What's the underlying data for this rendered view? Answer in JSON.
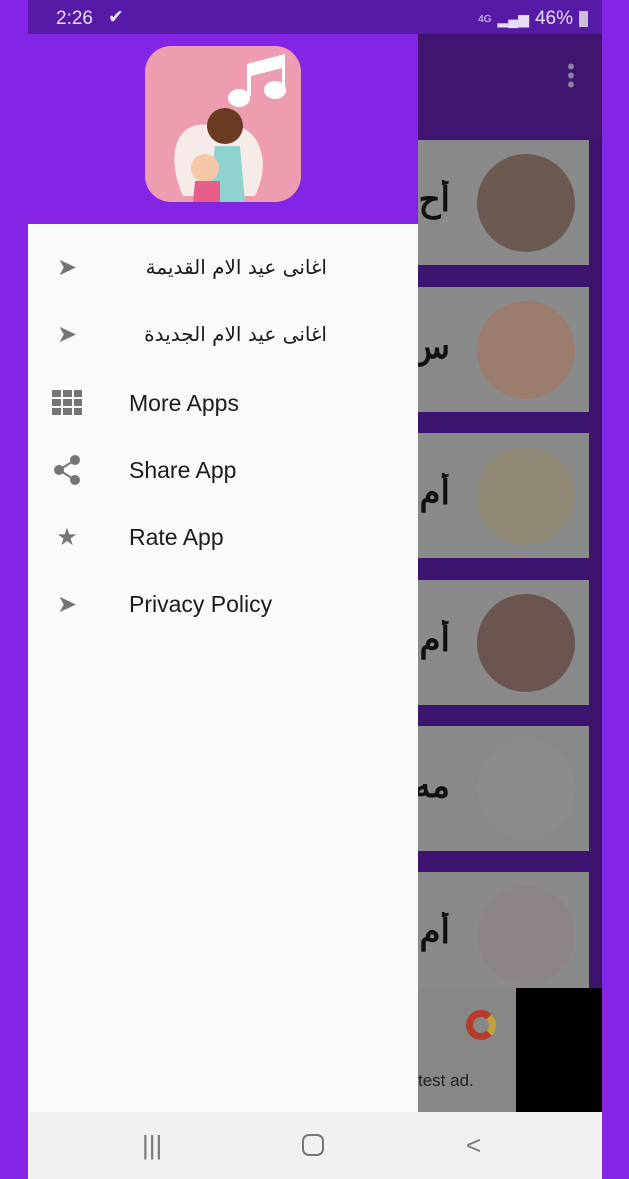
{
  "status_bar": {
    "time": "2:26",
    "network": "4G",
    "battery": "46%"
  },
  "background_list": {
    "cards": [
      {
        "title_fragment": "أح"
      },
      {
        "title_fragment": "س"
      },
      {
        "title_fragment": "أم"
      },
      {
        "title_fragment": "أم"
      },
      {
        "title_fragment": "مه"
      },
      {
        "title_fragment": "أم"
      }
    ],
    "ad_text": "test ad."
  },
  "drawer": {
    "items": [
      {
        "label": "اغانى عيد الام القديمة",
        "icon": "send-icon"
      },
      {
        "label": "اغانى عيد الام الجديدة",
        "icon": "send-icon"
      },
      {
        "label": "More Apps",
        "icon": "grid-icon"
      },
      {
        "label": "Share App",
        "icon": "share-icon"
      },
      {
        "label": "Rate App",
        "icon": "star-icon"
      },
      {
        "label": "Privacy Policy",
        "icon": "send-icon"
      }
    ]
  },
  "colors": {
    "frame": "#8424e4",
    "drawer_header": "#8424e4",
    "status_bar": "#571aa6"
  }
}
